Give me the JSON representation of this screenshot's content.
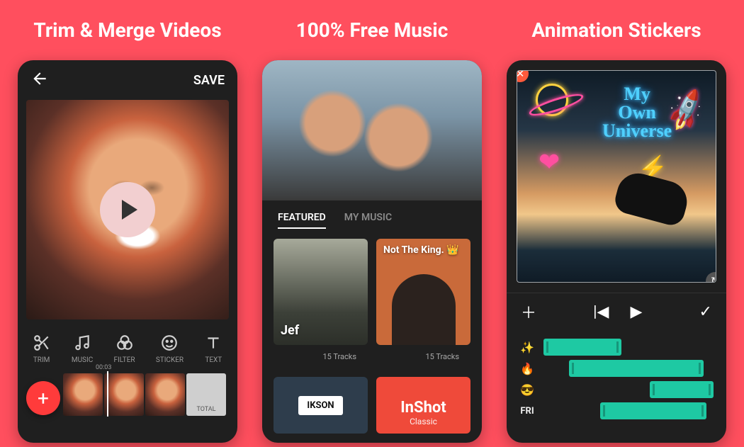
{
  "panels": {
    "trim": {
      "title": "Trim & Merge Videos"
    },
    "music": {
      "title": "100% Free Music"
    },
    "stickers": {
      "title": "Animation Stickers"
    }
  },
  "p1": {
    "save": "SAVE",
    "tools": [
      "TRIM",
      "MUSIC",
      "FILTER",
      "STICKER",
      "TEXT"
    ],
    "time": "00:03",
    "total": "TOTAL"
  },
  "p2": {
    "tabs": {
      "featured": "FEATURED",
      "my_music": "MY MUSIC"
    },
    "albums": [
      {
        "name": "Jef",
        "tracks": "15 Tracks"
      },
      {
        "name": "Not The King. 👑",
        "tracks": "15 Tracks"
      },
      {
        "name": "IKSON"
      },
      {
        "name": "InShot",
        "sub": "Classic"
      }
    ]
  },
  "p3": {
    "neon": [
      "My",
      "Own",
      "Universe"
    ],
    "emoji": {
      "planet": "🪐",
      "rocket": "🚀",
      "heart": "❤",
      "bolt": "⚡",
      "fire": "🔥",
      "cool": "😎"
    },
    "fri": "FRI"
  }
}
